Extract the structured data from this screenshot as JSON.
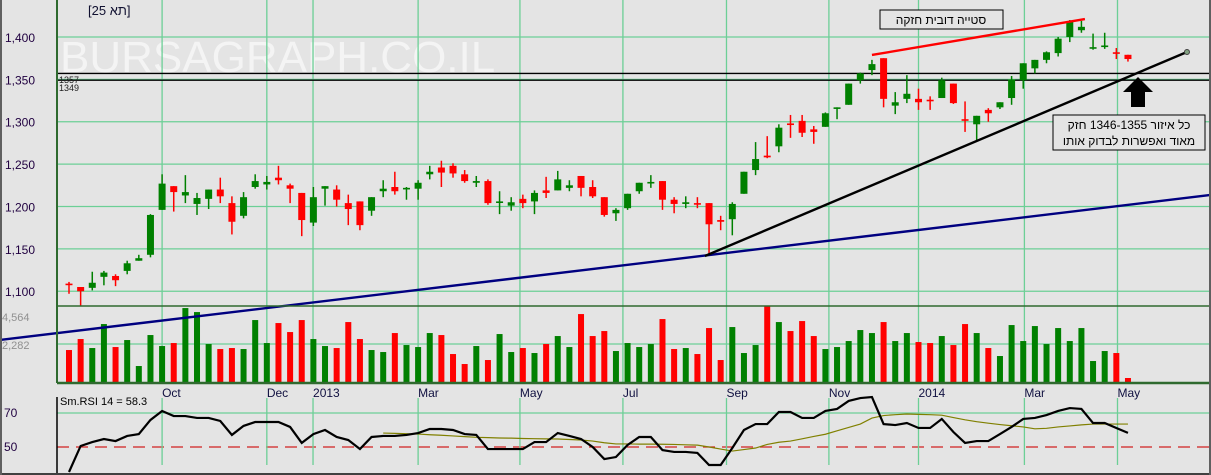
{
  "header": {
    "title": "[תא 25]",
    "watermark": "BURSAGRAPH.CO.IL"
  },
  "colors": {
    "up": "#008000",
    "down": "#ff0000",
    "grid": "#6ccf96",
    "axis": "#2f6a2f",
    "trend_blue": "#000080",
    "trend_black": "#000000",
    "resistance_red": "#ff0000",
    "rsi_signal": "#808000"
  },
  "annotations": {
    "bearish_divergence": "סטייה דובית חזקה",
    "support_note_line1": "כל איזור 1346-1355 חזק",
    "support_note_line2": "מאוד ואפשרות לבדוק אותו",
    "level_high": "1357",
    "level_low": "1349"
  },
  "chart_data": {
    "type": "candlestick",
    "title": "[תא 25]",
    "price_axis": {
      "ticks": [
        1400,
        1350,
        1300,
        1250,
        1200,
        1150,
        1100
      ],
      "tick_labels": [
        "1,400",
        "1,350",
        "1,300",
        "1,250",
        "1,200",
        "1,150",
        "1,100"
      ]
    },
    "volume_axis": {
      "ticks": [
        4564,
        2282
      ],
      "tick_labels": [
        "4,564",
        "2,282"
      ],
      "max": 4564
    },
    "rsi_axis": {
      "ticks": [
        70,
        50
      ],
      "tick_labels": [
        "70",
        "50"
      ]
    },
    "rsi_label": "Sm.RSI 14 = 58.3",
    "date_ticks": [
      {
        "label": "Oct",
        "index": 9.0
      },
      {
        "label": "Dec",
        "index": 18.0
      },
      {
        "label": "2013",
        "index": 21.97
      },
      {
        "label": "Mar",
        "index": 31.0
      },
      {
        "label": "May",
        "index": 39.75
      },
      {
        "label": "Jul",
        "index": 48.6
      },
      {
        "label": "Sep",
        "index": 57.5
      },
      {
        "label": "Nov",
        "index": 66.3
      },
      {
        "label": "2014",
        "index": 74.0
      },
      {
        "label": "Mar",
        "index": 83.1
      },
      {
        "label": "May",
        "index": 91.1
      }
    ],
    "ohlc": [
      [
        1109,
        1111,
        1097,
        1108
      ],
      [
        1105,
        1105,
        1083,
        1100
      ],
      [
        1104,
        1123,
        1101,
        1110
      ],
      [
        1117,
        1124,
        1107,
        1122
      ],
      [
        1118,
        1120,
        1106,
        1113
      ],
      [
        1124,
        1136,
        1120,
        1133
      ],
      [
        1136,
        1143,
        1136,
        1139
      ],
      [
        1143,
        1191,
        1140,
        1190
      ],
      [
        1196,
        1238,
        1196,
        1227
      ],
      [
        1224,
        1224,
        1194,
        1217
      ],
      [
        1213,
        1237,
        1204,
        1217
      ],
      [
        1203,
        1216,
        1190,
        1210
      ],
      [
        1209,
        1220,
        1197,
        1220
      ],
      [
        1220,
        1234,
        1204,
        1212
      ],
      [
        1204,
        1212,
        1167,
        1182
      ],
      [
        1189,
        1217,
        1186,
        1211
      ],
      [
        1223,
        1238,
        1221,
        1230
      ],
      [
        1226,
        1236,
        1220,
        1229
      ],
      [
        1234,
        1248,
        1226,
        1231
      ],
      [
        1225,
        1227,
        1204,
        1221
      ],
      [
        1216,
        1216,
        1165,
        1184
      ],
      [
        1181,
        1223,
        1177,
        1211
      ],
      [
        1221,
        1224,
        1201,
        1224
      ],
      [
        1220,
        1225,
        1200,
        1208
      ],
      [
        1204,
        1214,
        1178,
        1197
      ],
      [
        1206,
        1206,
        1172,
        1178
      ],
      [
        1195,
        1211,
        1189,
        1211
      ],
      [
        1218,
        1231,
        1211,
        1221
      ],
      [
        1223,
        1241,
        1214,
        1218
      ],
      [
        1221,
        1223,
        1208,
        1222
      ],
      [
        1221,
        1231,
        1208,
        1228
      ],
      [
        1238,
        1248,
        1232,
        1241
      ],
      [
        1246,
        1254,
        1223,
        1240
      ],
      [
        1248,
        1251,
        1234,
        1239
      ],
      [
        1238,
        1243,
        1228,
        1230
      ],
      [
        1228,
        1236,
        1223,
        1230
      ],
      [
        1230,
        1232,
        1202,
        1204
      ],
      [
        1205,
        1218,
        1191,
        1206
      ],
      [
        1201,
        1211,
        1195,
        1205
      ],
      [
        1209,
        1214,
        1198,
        1204
      ],
      [
        1206,
        1219,
        1191,
        1216
      ],
      [
        1219,
        1235,
        1210,
        1216
      ],
      [
        1219,
        1242,
        1219,
        1232
      ],
      [
        1222,
        1231,
        1218,
        1225
      ],
      [
        1236,
        1236,
        1212,
        1222
      ],
      [
        1223,
        1231,
        1210,
        1212
      ],
      [
        1211,
        1211,
        1188,
        1190
      ],
      [
        1192,
        1198,
        1183,
        1196
      ],
      [
        1198,
        1215,
        1196,
        1215
      ],
      [
        1218,
        1228,
        1215,
        1228
      ],
      [
        1228,
        1237,
        1222,
        1229
      ],
      [
        1230,
        1230,
        1196,
        1208
      ],
      [
        1208,
        1211,
        1192,
        1203
      ],
      [
        1203,
        1212,
        1198,
        1205
      ],
      [
        1204,
        1211,
        1198,
        1203
      ],
      [
        1204,
        1204,
        1144,
        1179
      ],
      [
        1184,
        1189,
        1172,
        1182
      ],
      [
        1185,
        1205,
        1166,
        1203
      ],
      [
        1215,
        1241,
        1215,
        1241
      ],
      [
        1243,
        1276,
        1237,
        1256
      ],
      [
        1260,
        1283,
        1257,
        1258
      ],
      [
        1271,
        1297,
        1264,
        1293
      ],
      [
        1298,
        1308,
        1281,
        1297
      ],
      [
        1301,
        1308,
        1282,
        1287
      ],
      [
        1291,
        1295,
        1274,
        1288
      ],
      [
        1294,
        1311,
        1294,
        1310
      ],
      [
        1316,
        1317,
        1303,
        1317
      ],
      [
        1320,
        1345,
        1320,
        1345
      ],
      [
        1349,
        1358,
        1345,
        1357
      ],
      [
        1361,
        1373,
        1355,
        1368
      ],
      [
        1375,
        1375,
        1317,
        1327
      ],
      [
        1319,
        1335,
        1309,
        1323
      ],
      [
        1327,
        1355,
        1322,
        1333
      ],
      [
        1327,
        1339,
        1314,
        1323
      ],
      [
        1326,
        1330,
        1314,
        1325
      ],
      [
        1328,
        1352,
        1328,
        1349
      ],
      [
        1345,
        1345,
        1321,
        1322
      ],
      [
        1303,
        1324,
        1288,
        1302
      ],
      [
        1297,
        1307,
        1278,
        1307
      ],
      [
        1314,
        1316,
        1300,
        1310
      ],
      [
        1317,
        1323,
        1315,
        1323
      ],
      [
        1328,
        1354,
        1320,
        1350
      ],
      [
        1349,
        1369,
        1339,
        1369
      ],
      [
        1363,
        1373,
        1357,
        1373
      ],
      [
        1373,
        1383,
        1369,
        1382
      ],
      [
        1381,
        1400,
        1377,
        1398
      ],
      [
        1400,
        1420,
        1394,
        1418
      ],
      [
        1408,
        1419,
        1405,
        1412
      ],
      [
        1387,
        1404,
        1385,
        1388
      ],
      [
        1389,
        1405,
        1386,
        1390
      ],
      [
        1382,
        1387,
        1374,
        1381
      ],
      [
        1379,
        1379,
        1371,
        1374
      ]
    ],
    "volume": [
      1920,
      2580,
      2040,
      3480,
      2100,
      2520,
      960,
      2820,
      2160,
      2340,
      4440,
      4200,
      2280,
      1980,
      2040,
      1980,
      3720,
      2340,
      3540,
      3000,
      3720,
      2580,
      2160,
      2040,
      3600,
      2580,
      1920,
      1800,
      2940,
      2220,
      2100,
      2940,
      2820,
      1680,
      1080,
      2160,
      1320,
      2880,
      1800,
      2040,
      1740,
      2280,
      2760,
      2100,
      4080,
      2760,
      3060,
      1860,
      2340,
      2100,
      2280,
      3780,
      1980,
      2040,
      1680,
      3240,
      1320,
      3300,
      1740,
      2220,
      4560,
      3600,
      3060,
      3660,
      2760,
      1980,
      2100,
      2460,
      3120,
      2940,
      3600,
      2460,
      2940,
      2400,
      2340,
      2760,
      2220,
      3480,
      2940,
      2040,
      1560,
      3420,
      2460,
      3360,
      2280,
      3240,
      2460,
      3240,
      1260,
      1860,
      1740,
      240
    ],
    "rsi": [
      35.3,
      50.6,
      52.9,
      54.7,
      53.5,
      56.5,
      57.6,
      65.9,
      71.2,
      68.2,
      68.2,
      67.1,
      67.1,
      65.3,
      57.1,
      62.4,
      64.7,
      64.7,
      64.7,
      61.8,
      52.4,
      57.6,
      60,
      55.9,
      54.1,
      48.8,
      55.9,
      56.5,
      56.5,
      57.1,
      58.2,
      60.6,
      60.6,
      60,
      57.6,
      57.1,
      48.8,
      48.8,
      48.8,
      48.8,
      52.9,
      52.9,
      58.2,
      56.5,
      54.7,
      50,
      42.9,
      44.1,
      51.2,
      55.9,
      55.9,
      48.2,
      47.1,
      47.1,
      46.5,
      39.4,
      39.4,
      49.4,
      60,
      63.5,
      63.5,
      70.6,
      70.6,
      67.1,
      67.1,
      71.2,
      72.4,
      77.1,
      78.8,
      79.4,
      63.5,
      62.9,
      64.1,
      61.2,
      61.2,
      66.5,
      58.8,
      52.4,
      53.5,
      53.5,
      57.6,
      61.8,
      66.5,
      67.1,
      68.8,
      71.2,
      72.9,
      72.4,
      64.1,
      64.1,
      61.2,
      58.3
    ],
    "rsi_signal": [
      null,
      null,
      null,
      null,
      null,
      null,
      null,
      null,
      null,
      null,
      null,
      null,
      null,
      null,
      null,
      null,
      null,
      null,
      null,
      null,
      null,
      null,
      null,
      null,
      null,
      null,
      null,
      58.2,
      58,
      57.8,
      57.6,
      57.2,
      56.9,
      56.5,
      56.1,
      55.7,
      55.5,
      55.3,
      55.2,
      55,
      54.9,
      54.8,
      54.7,
      54.4,
      54.1,
      53.5,
      52.5,
      51.8,
      51.8,
      51.7,
      51.7,
      51.6,
      51.5,
      51.3,
      51.1,
      50,
      48.8,
      47.6,
      48.5,
      49.4,
      51.5,
      52.8,
      53.5,
      54.8,
      56.2,
      57.5,
      59.5,
      61.5,
      63.5,
      67,
      68.5,
      69,
      69.4,
      69.2,
      69,
      68.7,
      67.3,
      66,
      64.9,
      64,
      63.2,
      62.5,
      61.8,
      60.7,
      61,
      61.8,
      62.4,
      63,
      63.5,
      63.5,
      63.5,
      63.5
    ],
    "horizontal_levels": [
      1357,
      1349
    ],
    "trendlines": [
      {
        "name": "long-term-support",
        "color": "#000080",
        "points": [
          [
            -4.93,
            1042.5
          ],
          [
            99.1,
            1213.6
          ]
        ]
      },
      {
        "name": "uptrend-support",
        "color": "#000000",
        "points": [
          [
            55.65,
            1141.6
          ],
          [
            97.07,
            1382.3
          ]
        ]
      },
      {
        "name": "bearish-divergence-highs",
        "color": "#ff0000",
        "points": [
          [
            70.0,
            1378.8
          ],
          [
            88.3,
            1421.2
          ]
        ]
      }
    ],
    "grid": true
  }
}
